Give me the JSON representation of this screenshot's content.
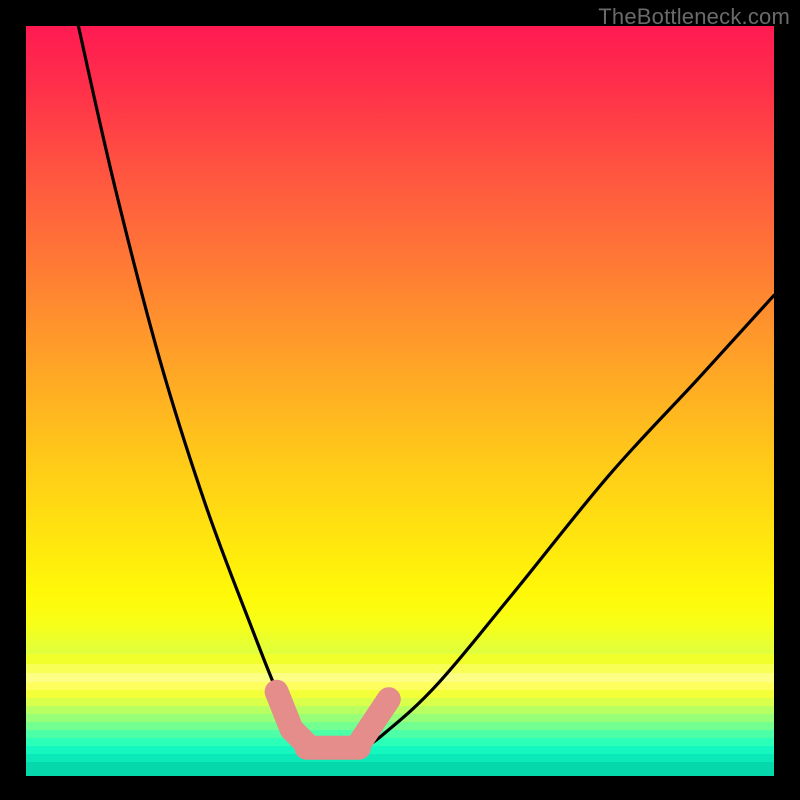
{
  "watermark": "TheBottleneck.com",
  "chart_data": {
    "type": "line",
    "title": "",
    "xlabel": "",
    "ylabel": "",
    "xlim": [
      0,
      1
    ],
    "ylim": [
      0,
      1
    ],
    "notes": "Axes and ticks are not shown in the image; values are normalized 0–1. y ≈ 1 at top (red) and y ≈ 0 at bottom (green). Curve approximates a V-shaped bottleneck profile with a flat minimum near x ≈ 0.37–0.45, y ≈ 0.03, rising steeply on the left toward (0.07, 1.0) and gently on the right toward (1.0, 0.64). A short pink highlight segment overlays the curve around the minimum on both sides.",
    "series": [
      {
        "name": "bottleneck-curve",
        "x": [
          0.07,
          0.12,
          0.18,
          0.24,
          0.3,
          0.34,
          0.37,
          0.4,
          0.43,
          0.45,
          0.48,
          0.55,
          0.65,
          0.78,
          0.9,
          1.0
        ],
        "y": [
          1.0,
          0.78,
          0.55,
          0.36,
          0.2,
          0.1,
          0.045,
          0.03,
          0.03,
          0.035,
          0.055,
          0.12,
          0.24,
          0.4,
          0.53,
          0.64
        ]
      },
      {
        "name": "pink-highlight-left",
        "x": [
          0.335,
          0.355,
          0.375
        ],
        "y": [
          0.11,
          0.06,
          0.04
        ]
      },
      {
        "name": "pink-highlight-bottom",
        "x": [
          0.375,
          0.445
        ],
        "y": [
          0.035,
          0.035
        ]
      },
      {
        "name": "pink-highlight-right",
        "x": [
          0.445,
          0.465,
          0.485
        ],
        "y": [
          0.04,
          0.07,
          0.1
        ]
      }
    ],
    "background_gradient": {
      "top": "#ff1a52",
      "mid": "#ffe40f",
      "bottom": "#1affc2"
    }
  }
}
